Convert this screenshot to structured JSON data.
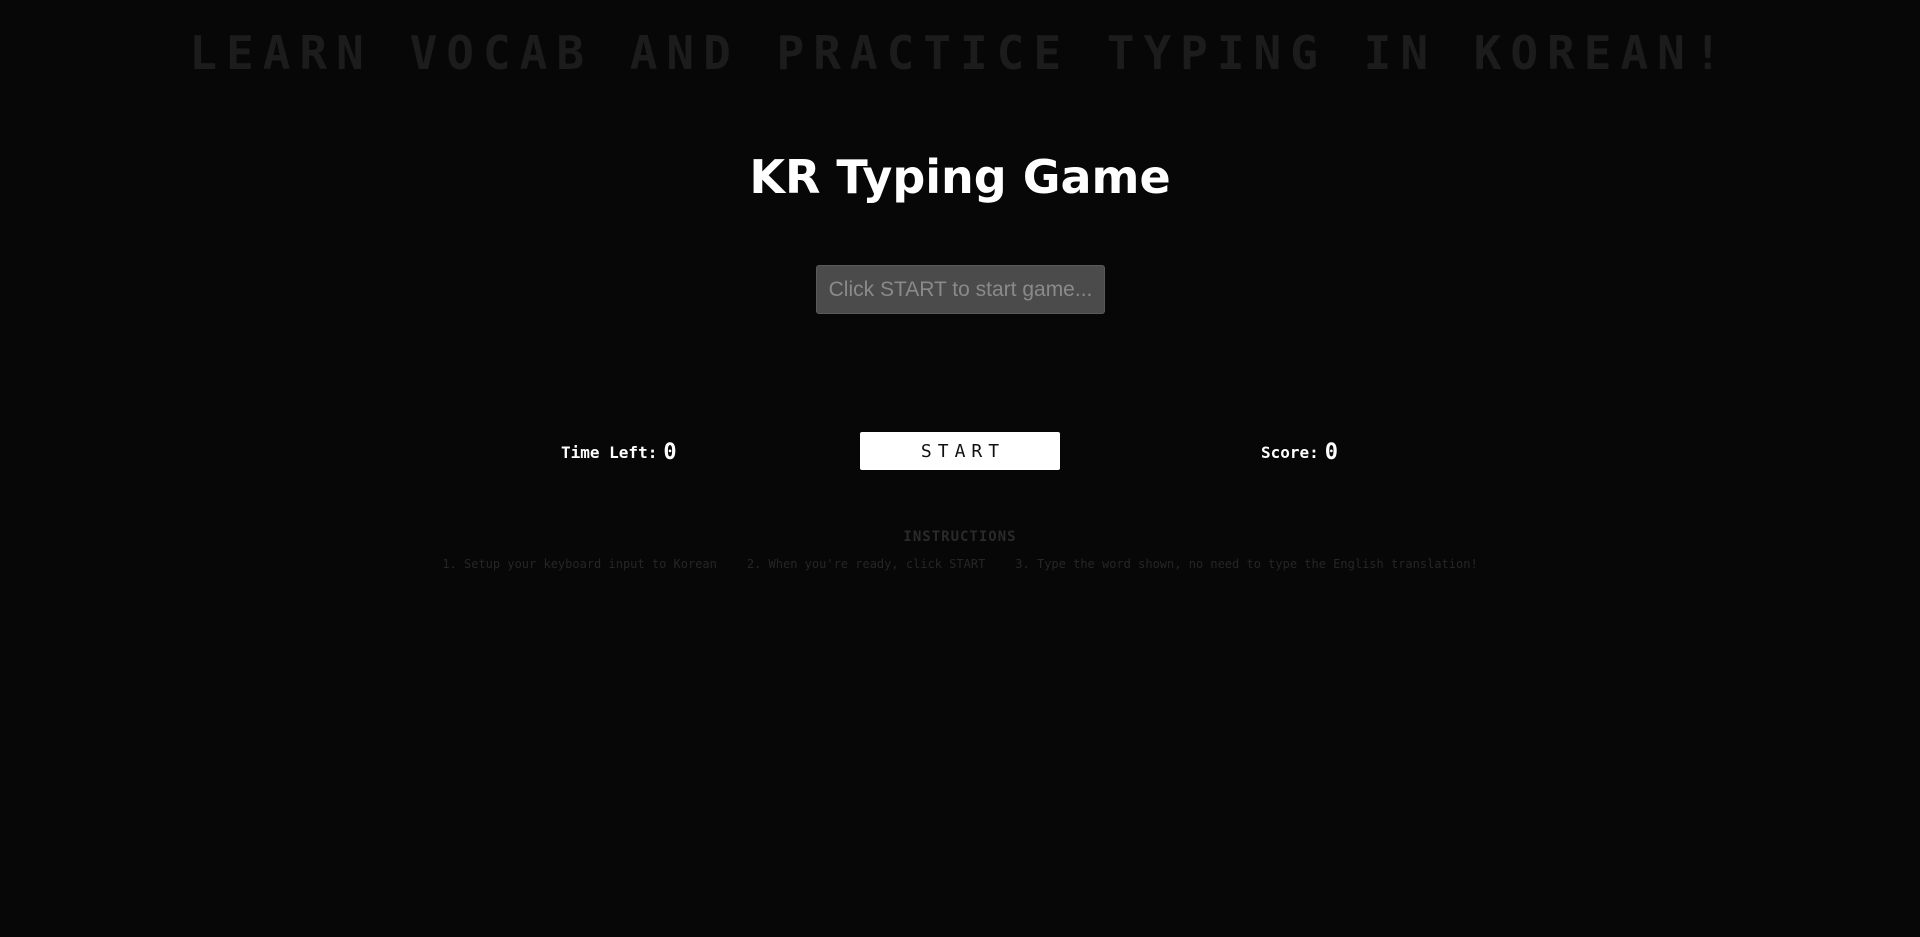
{
  "banner": "LEARN VOCAB AND PRACTICE TYPING IN KOREAN!",
  "game": {
    "title": "KR Typing Game",
    "word_prompt": "Click START to start game..."
  },
  "stats": {
    "time_label": "Time Left:",
    "time_value": "0",
    "score_label": "Score:",
    "score_value": "0"
  },
  "controls": {
    "start_label": "START"
  },
  "instructions": {
    "title": "INSTRUCTIONS",
    "steps": [
      "1. Setup your keyboard input to Korean",
      "2. When you're ready, click START",
      "3. Type the word shown, no need to type the English translation!"
    ]
  },
  "colors": {
    "background": "#070707",
    "banner_text": "#1c1c1c",
    "word_box": "#4b4b4b",
    "button_bg": "#ffffff"
  }
}
